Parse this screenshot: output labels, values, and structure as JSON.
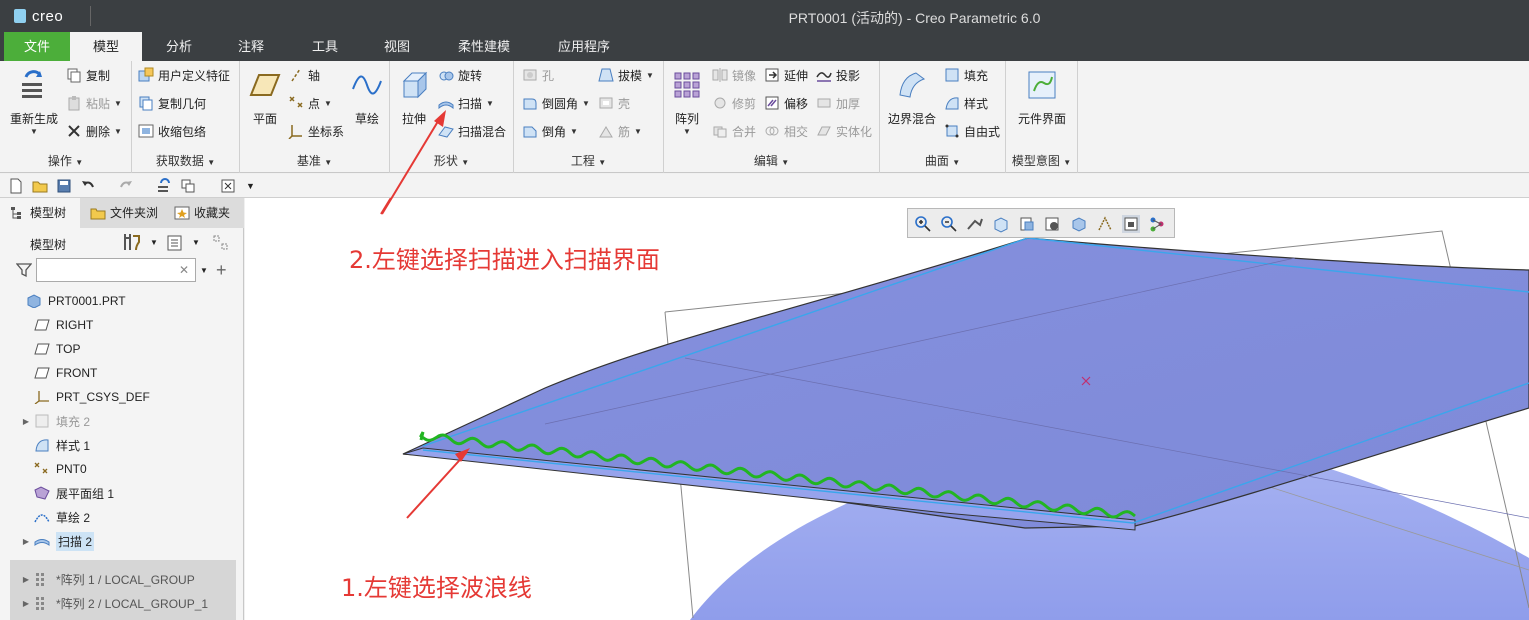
{
  "window": {
    "app_logo": "creo",
    "title": "PRT0001 (活动的) - Creo Parametric 6.0"
  },
  "tabs": [
    {
      "label": "文件"
    },
    {
      "label": "模型"
    },
    {
      "label": "分析"
    },
    {
      "label": "注释"
    },
    {
      "label": "工具"
    },
    {
      "label": "视图"
    },
    {
      "label": "柔性建模"
    },
    {
      "label": "应用程序"
    }
  ],
  "ribbon": {
    "operations": {
      "label": "操作",
      "regenerate": "重新生成",
      "copy": "复制",
      "paste": "粘贴",
      "delete": "删除"
    },
    "get_data": {
      "label": "获取数据",
      "udf": "用户定义特征",
      "copy_geom": "复制几何",
      "shrinkwrap": "收缩包络"
    },
    "datum": {
      "label": "基准",
      "plane": "平面",
      "axis": "轴",
      "point": "点",
      "csys": "坐标系",
      "sketch": "草绘"
    },
    "shapes": {
      "label": "形状",
      "extrude": "拉伸",
      "revolve": "旋转",
      "sweep": "扫描",
      "swept_blend": "扫描混合"
    },
    "engineering": {
      "label": "工程",
      "hole": "孔",
      "round": "倒圆角",
      "chamfer": "倒角",
      "draft": "拔模",
      "shell": "壳",
      "rib": "筋"
    },
    "editing": {
      "label": "编辑",
      "pattern": "阵列",
      "mirror": "镜像",
      "trim": "修剪",
      "merge": "合并",
      "extend": "延伸",
      "offset": "偏移",
      "intersect": "相交",
      "project": "投影",
      "thicken": "加厚",
      "solidify": "实体化"
    },
    "surfaces": {
      "label": "曲面",
      "boundary_blend": "边界混合",
      "fill": "填充",
      "style": "样式",
      "freestyle": "自由式"
    },
    "model_intent": {
      "label": "模型意图",
      "component_interface": "元件界面"
    }
  },
  "left_panel": {
    "tabs": [
      {
        "label": "模型树"
      },
      {
        "label": "文件夹浏"
      },
      {
        "label": "收藏夹"
      }
    ],
    "tree_header": "模型树",
    "filter_placeholder": "",
    "nodes": [
      {
        "label": "PRT0001.PRT"
      },
      {
        "label": "RIGHT"
      },
      {
        "label": "TOP"
      },
      {
        "label": "FRONT"
      },
      {
        "label": "PRT_CSYS_DEF"
      },
      {
        "label": "填充 2"
      },
      {
        "label": "样式 1"
      },
      {
        "label": "PNT0"
      },
      {
        "label": "展平面组 1"
      },
      {
        "label": "草绘 2"
      },
      {
        "label": "扫描 2"
      },
      {
        "label": "*阵列 1 / LOCAL_GROUP"
      },
      {
        "label": "*阵列 2 / LOCAL_GROUP_1"
      }
    ]
  },
  "annotations": {
    "step2": "2.左键选择扫描进入扫描界面",
    "step1": "1.左键选择波浪线"
  },
  "colors": {
    "titlebar": "#3b3f42",
    "file_tab": "#4cae3a",
    "surface": "#8a97e2",
    "wave": "#22b522",
    "annotation": "#e53935"
  }
}
